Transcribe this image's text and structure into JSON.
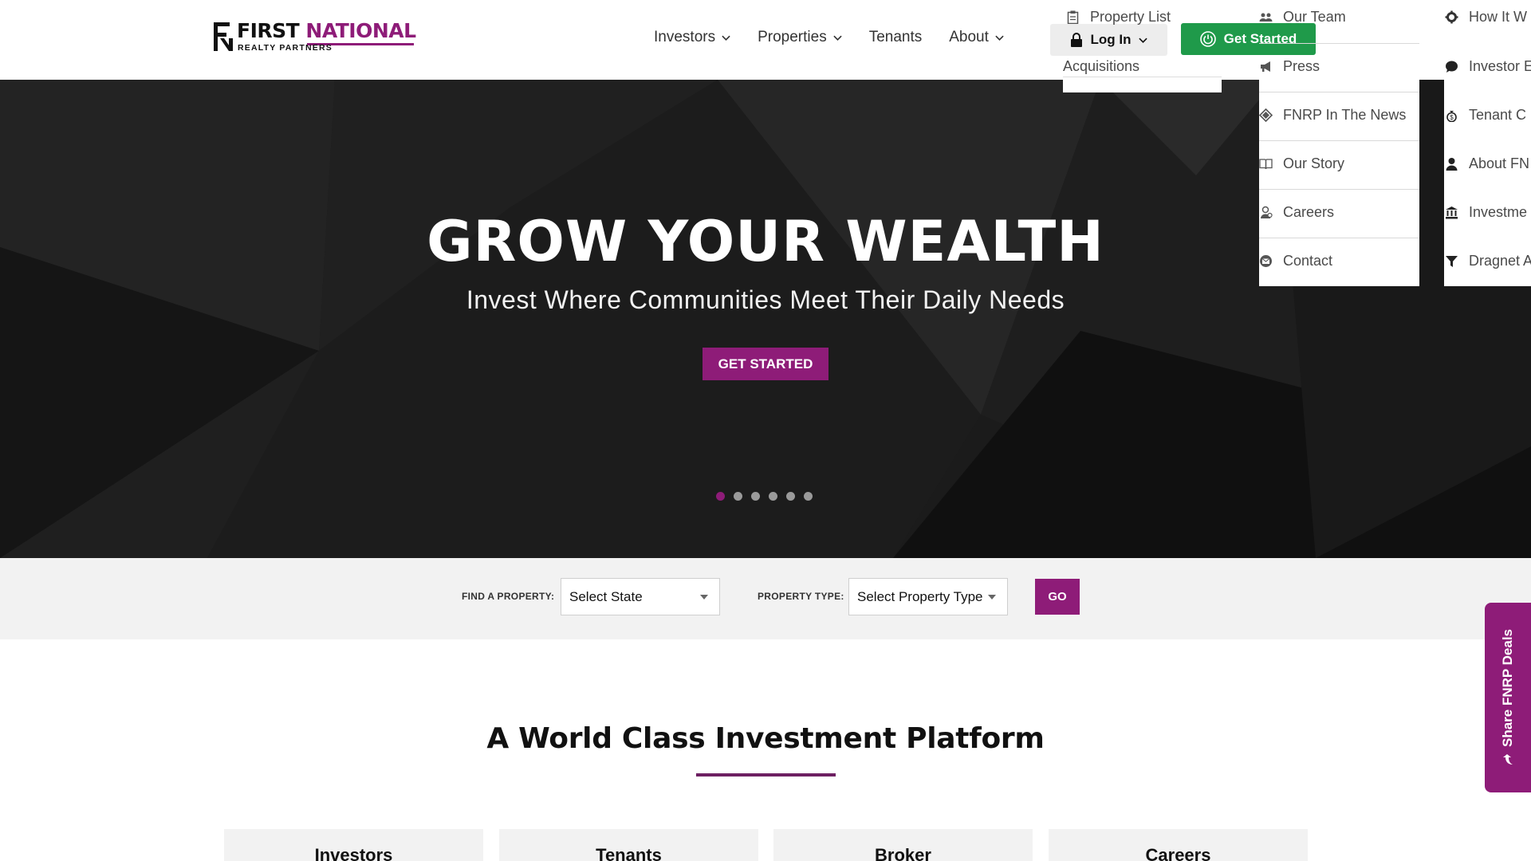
{
  "brand": {
    "name_first": "FIRST",
    "name_second": "NATIONAL",
    "tagline": "REALTY PARTNERS",
    "accent_color": "#8e1c78",
    "green_color": "#1f9a4a"
  },
  "nav": {
    "items": [
      {
        "label": "Investors",
        "has_dropdown": true
      },
      {
        "label": "Properties",
        "has_dropdown": true
      },
      {
        "label": "Tenants",
        "has_dropdown": false
      },
      {
        "label": "About",
        "has_dropdown": true
      }
    ],
    "login_label": "Log In",
    "get_started_label": "Get Started"
  },
  "dropdowns": {
    "properties": [
      {
        "label": "Property List",
        "icon": "clipboard-icon"
      },
      {
        "label": "Acquisitions",
        "icon": ""
      }
    ],
    "about": [
      {
        "label": "Our Team",
        "icon": "team-icon"
      },
      {
        "label": "Press",
        "icon": "megaphone-icon"
      },
      {
        "label": "FNRP In The News",
        "icon": "newspaper-icon"
      },
      {
        "label": "Our Story",
        "icon": "book-icon"
      },
      {
        "label": "Careers",
        "icon": "careers-icon"
      },
      {
        "label": "Contact",
        "icon": "envelope-icon"
      }
    ],
    "investors": [
      {
        "label": "How It W",
        "icon": "gear-icon"
      },
      {
        "label": "Investor E",
        "icon": "chat-icon"
      },
      {
        "label": "Tenant C",
        "icon": "money-bag-icon"
      },
      {
        "label": "About FN",
        "icon": "person-icon"
      },
      {
        "label": "Investme",
        "icon": "bank-icon"
      },
      {
        "label": "Dragnet A",
        "icon": "filter-icon"
      }
    ]
  },
  "hero": {
    "title": "GROW YOUR WEALTH",
    "subtitle": "Invest Where Communities Meet Their Daily Needs",
    "cta_label": "GET STARTED",
    "slide_count": 6,
    "active_slide": 1
  },
  "search": {
    "find_label": "FIND A PROPERTY:",
    "state_placeholder": "Select State",
    "type_label": "PROPERTY TYPE:",
    "type_placeholder": "Select Property Type",
    "go_label": "GO"
  },
  "platform": {
    "title": "A World Class Investment Platform",
    "cards": [
      "Investors",
      "Tenants",
      "Broker",
      "Careers"
    ]
  },
  "share_tab": {
    "label": "Share FNRP Deals",
    "icon": "share-arrow-icon"
  }
}
